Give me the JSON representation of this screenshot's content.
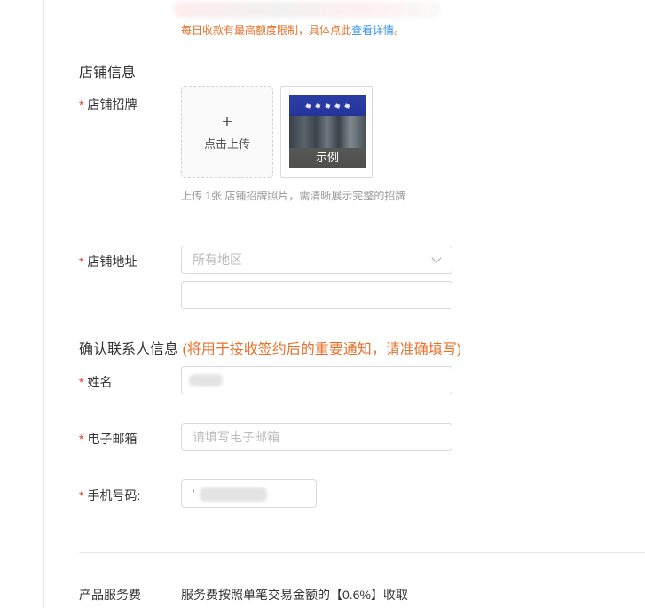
{
  "notice": {
    "text": "每日收款有最高额度限制，具体点此",
    "link": "查看详情",
    "suffix": "。"
  },
  "shop_info": {
    "title": "店铺信息",
    "signboard": {
      "label": "店铺招牌",
      "upload_plus": "+",
      "upload_text": "点击上传",
      "example_caption": "示例",
      "help": "上传 1张 店铺招牌照片，需清晰展示完整的招牌"
    },
    "address": {
      "label": "店铺地址",
      "region_placeholder": "所有地区",
      "detail_value": ""
    }
  },
  "contact": {
    "title": "确认联系人信息",
    "hint": "(将用于接收签约后的重要通知，请准确填写)",
    "name_label": "姓名",
    "email_label": "电子邮箱",
    "email_placeholder": "请填写电子邮箱",
    "phone_label": "手机号码:",
    "phone_prefix": "'"
  },
  "fee": {
    "label": "产品服务费",
    "value": "服务费按照单笔交易金额的【0.6%】收取"
  },
  "required_mark": "*",
  "colors": {
    "accent_orange": "#e8702a",
    "link_blue": "#2d8cf0",
    "required_red": "#e8382d"
  }
}
